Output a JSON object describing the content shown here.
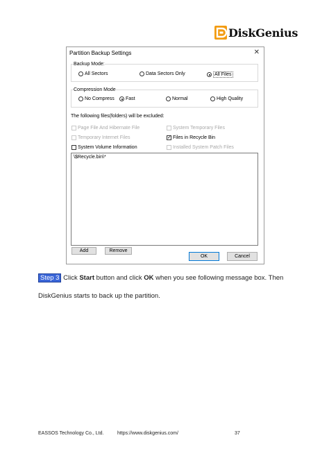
{
  "brand": {
    "name": "DiskGenius",
    "icon": "diskgenius-logo-icon",
    "color": "#f39c12"
  },
  "dialog": {
    "title": "Partition Backup Settings",
    "close_glyph": "✕",
    "backup_mode": {
      "label": "Backup Mode:",
      "options": [
        "All Sectors",
        "Data Sectors Only",
        "All Files"
      ],
      "selected": "All Files"
    },
    "compression_mode": {
      "label": "Compression Mode",
      "options": [
        "No Compress",
        "Fast",
        "Normal",
        "High Quality"
      ],
      "selected": "Fast"
    },
    "excluded_label": "The following files(folders) will be excluded:",
    "exclusions": {
      "page_file": {
        "label": "Page File And Hibernate File",
        "checked": false,
        "enabled": false
      },
      "system_temp": {
        "label": "System Temporary Files",
        "checked": false,
        "enabled": false
      },
      "temp_internet": {
        "label": "Temporary Internet Files",
        "checked": false,
        "enabled": false
      },
      "recycle_bin": {
        "label": "Files in Recycle Bin",
        "checked": true,
        "enabled": true
      },
      "system_volume": {
        "label": "System Volume Information",
        "checked": false,
        "enabled": true
      },
      "system_patch": {
        "label": "Installed System Patch Files",
        "checked": false,
        "enabled": false
      }
    },
    "excluded_list": [
      "\\$Recycle.bin\\*"
    ],
    "buttons": {
      "add": "Add",
      "remove": "Remove",
      "ok": "OK",
      "cancel": "Cancel"
    }
  },
  "instructions": {
    "step_label": "Step 3",
    "line1_a": " Click ",
    "start": "Start",
    "line1_b": " button and click ",
    "ok": "OK",
    "line1_c": " when you see following message box. Then",
    "line2": "DiskGenius starts to back up the partition."
  },
  "footer": {
    "company": "EASSOS Technology Co., Ltd.",
    "url": "https://www.diskgenius.com/",
    "page_number": "37"
  }
}
